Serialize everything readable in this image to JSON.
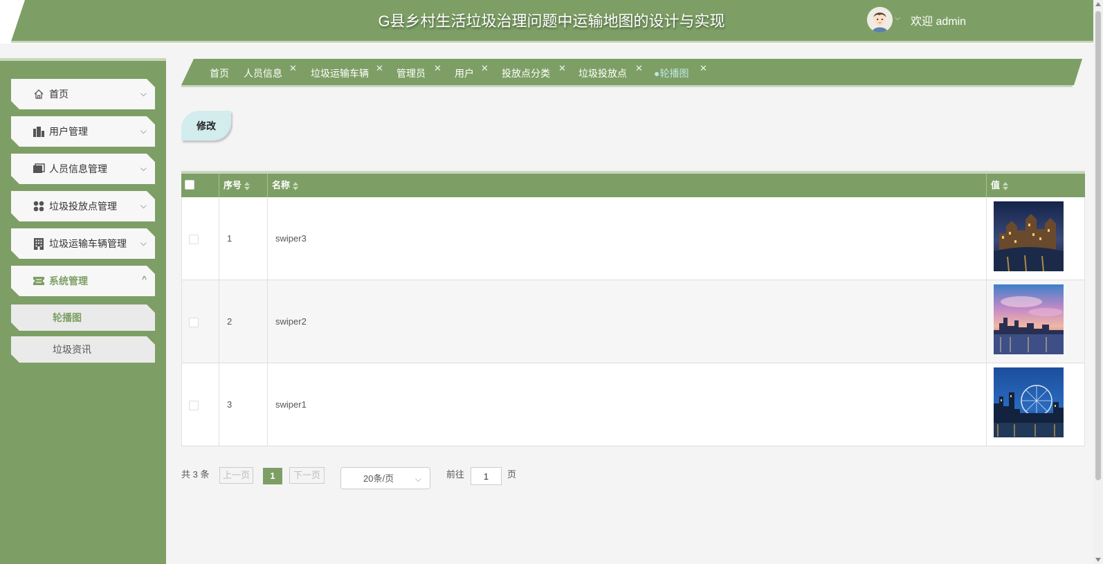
{
  "header": {
    "title": "G县乡村生活垃圾治理问题中运输地图的设计与实现",
    "welcome": "欢迎 admin",
    "caret": "⌵"
  },
  "sidebar": {
    "items": [
      {
        "label": "首页",
        "icon": "home-icon",
        "caret": "⌵"
      },
      {
        "label": "用户管理",
        "icon": "users-building-icon",
        "caret": "⌵"
      },
      {
        "label": "人员信息管理",
        "icon": "folder-icon",
        "caret": "⌵"
      },
      {
        "label": "垃圾投放点管理",
        "icon": "grid-dots-icon",
        "caret": "⌵"
      },
      {
        "label": "垃圾运输车辆管理",
        "icon": "building-icon",
        "caret": "⌵"
      },
      {
        "label": "系统管理",
        "icon": "ticket-icon",
        "caret": "^"
      }
    ],
    "subitems": [
      {
        "label": "轮播图"
      },
      {
        "label": "垃圾资讯"
      }
    ]
  },
  "tabs": [
    {
      "label": "首页",
      "close": ""
    },
    {
      "label": "人员信息",
      "close": "✕"
    },
    {
      "label": "垃圾运输车辆",
      "close": "✕"
    },
    {
      "label": "管理员",
      "close": "✕"
    },
    {
      "label": "用户",
      "close": "✕"
    },
    {
      "label": "投放点分类",
      "close": "✕"
    },
    {
      "label": "垃圾投放点",
      "close": "✕"
    },
    {
      "label": "●轮播图",
      "close": "✕"
    }
  ],
  "toolbar": {
    "edit_label": "修改"
  },
  "table": {
    "columns": [
      "序号",
      "名称",
      "值"
    ],
    "rows": [
      {
        "index": "1",
        "name": "swiper3"
      },
      {
        "index": "2",
        "name": "swiper2"
      },
      {
        "index": "3",
        "name": "swiper1"
      }
    ]
  },
  "pagination": {
    "total": "共 3 条",
    "prev": "上一页",
    "current": "1",
    "next": "下一页",
    "page_size": "20条/页",
    "size_arrow": "⌵",
    "goto": "前往",
    "goto_value": "1",
    "page_suffix": "页"
  },
  "colors": {
    "accent": "#7d9f65",
    "edit_button": "#d3ecee",
    "active_tab_text": "#bfe6e2"
  }
}
